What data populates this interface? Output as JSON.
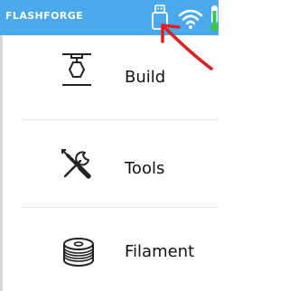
{
  "status_bar": {
    "brand": "FLASHFORGE",
    "background_color": "#4aa8ec",
    "icons": [
      "usb-icon",
      "wifi-icon",
      "thermometer-icon"
    ]
  },
  "menu": {
    "items": [
      {
        "label": "Build",
        "icon": "build-icon"
      },
      {
        "label": "Tools",
        "icon": "tools-icon"
      },
      {
        "label": "Filament",
        "icon": "filament-icon"
      }
    ]
  },
  "annotation": {
    "color": "#e02020",
    "icon": "red-arrow-annotation"
  }
}
